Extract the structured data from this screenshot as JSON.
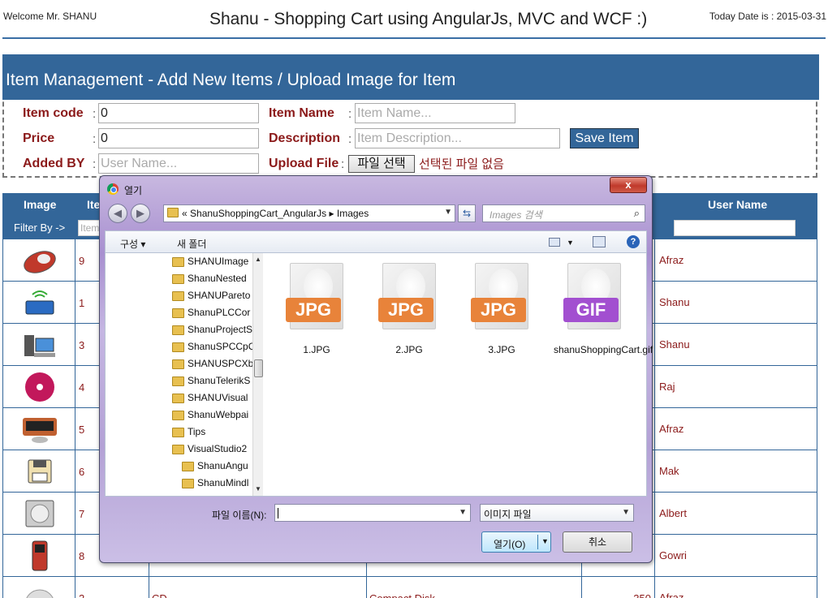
{
  "header": {
    "welcome": "Welcome Mr. SHANU",
    "title": "Shanu - Shopping Cart using AngularJs, MVC and WCF :)",
    "today": "Today Date is : 2015-03-31"
  },
  "form": {
    "heading": "Item Management - Add New Items / Upload Image for Item",
    "item_code_label": "Item code",
    "item_code_value": "0",
    "price_label": "Price",
    "price_value": "0",
    "added_by_label": "Added BY",
    "added_by_placeholder": "User Name...",
    "item_name_label": "Item Name",
    "item_name_placeholder": "Item Name...",
    "description_label": "Description",
    "description_placeholder": "Item Description...",
    "upload_label": "Upload File",
    "choose_file_label": "파일 선택",
    "no_file_text": "선택된 파일 없음",
    "save_label": "Save Item",
    "colon": ":"
  },
  "table": {
    "headers": {
      "image": "Image",
      "item": "Ite",
      "user": "User Name"
    },
    "filter_label": "Filter By ->",
    "filter_placeholder": "Item",
    "rows": [
      {
        "code": "9",
        "user": "Afraz",
        "icon": "mouse-icon"
      },
      {
        "code": "1",
        "user": "Shanu",
        "icon": "router-icon"
      },
      {
        "code": "3",
        "user": "Shanu",
        "icon": "computer-icon"
      },
      {
        "code": "4",
        "user": "Raj",
        "icon": "dvd-icon"
      },
      {
        "code": "5",
        "user": "Afraz",
        "icon": "dvd-player-icon"
      },
      {
        "code": "6",
        "user": "Mak",
        "icon": "floppy-icon"
      },
      {
        "code": "7",
        "user": "Albert",
        "icon": "hard-disk-icon"
      },
      {
        "code": "8",
        "user": "Gowri",
        "icon": "mobile-phone-icon"
      },
      {
        "code": "2",
        "name": "CD",
        "description": "Compact Disk",
        "price": "350",
        "user": "Afraz",
        "icon": "cd-icon"
      }
    ]
  },
  "dialog": {
    "title": "열기",
    "close": "x",
    "address_prefix": "«",
    "address_path": "ShanuShoppingCart_AngularJs",
    "address_sep": "▸",
    "address_current": "Images",
    "search_placeholder": "Images 검색",
    "organize": "구성 ▾",
    "new_folder": "새 폴더",
    "tree": [
      {
        "label": "SHANUImage",
        "indent": 0
      },
      {
        "label": "ShanuNested",
        "indent": 0
      },
      {
        "label": "SHANUPareto",
        "indent": 0
      },
      {
        "label": "ShanuPLCCor",
        "indent": 0
      },
      {
        "label": "ShanuProjectS",
        "indent": 0
      },
      {
        "label": "ShanuSPCCpC",
        "indent": 0
      },
      {
        "label": "SHANUSPCXb",
        "indent": 0
      },
      {
        "label": "ShanuTelerikS",
        "indent": 0
      },
      {
        "label": "SHANUVisual",
        "indent": 0
      },
      {
        "label": "ShanuWebpai",
        "indent": 0
      },
      {
        "label": "Tips",
        "indent": 0
      },
      {
        "label": "VisualStudio2",
        "indent": 0
      },
      {
        "label": "ShanuAngu",
        "indent": 1
      },
      {
        "label": "ShanuMindl",
        "indent": 1
      }
    ],
    "files": [
      {
        "name": "1.JPG",
        "type": "JPG",
        "color": "#e8833a"
      },
      {
        "name": "2.JPG",
        "type": "JPG",
        "color": "#e8833a"
      },
      {
        "name": "3.JPG",
        "type": "JPG",
        "color": "#e8833a"
      },
      {
        "name": "shanuShoppingCart.gif",
        "type": "GIF",
        "color": "#a24fd0"
      }
    ],
    "filename_label": "파일 이름(N):",
    "filetype_value": "이미지 파일",
    "open_label": "열기(O)",
    "cancel_label": "취소"
  },
  "colors": {
    "accent": "#336699",
    "label_red": "#8b1a1a"
  }
}
